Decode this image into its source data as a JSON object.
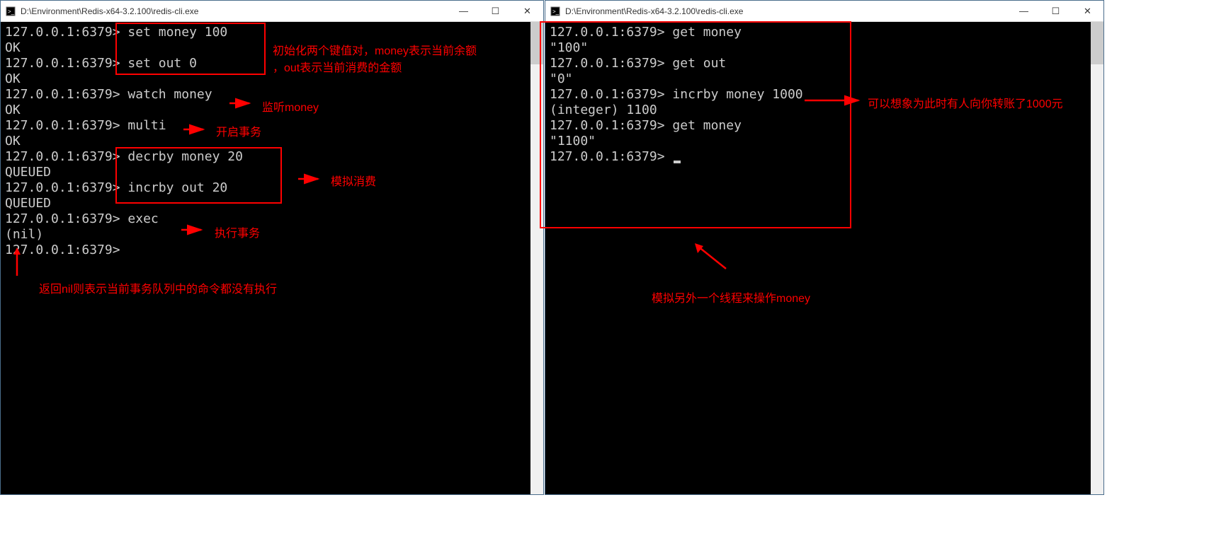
{
  "left": {
    "title": "D:\\Environment\\Redis-x64-3.2.100\\redis-cli.exe",
    "lines": [
      "127.0.0.1:6379> set money 100",
      "OK",
      "127.0.0.1:6379> set out 0",
      "OK",
      "127.0.0.1:6379> watch money",
      "OK",
      "127.0.0.1:6379> multi",
      "OK",
      "127.0.0.1:6379> decrby money 20",
      "QUEUED",
      "127.0.0.1:6379> incrby out 20",
      "QUEUED",
      "127.0.0.1:6379> exec",
      "(nil)",
      "127.0.0.1:6379>"
    ]
  },
  "right": {
    "title": "D:\\Environment\\Redis-x64-3.2.100\\redis-cli.exe",
    "lines": [
      "127.0.0.1:6379> get money",
      "\"100\"",
      "127.0.0.1:6379> get out",
      "\"0\"",
      "127.0.0.1:6379> incrby money 1000",
      "(integer) 1100",
      "127.0.0.1:6379> get money",
      "\"1100\"",
      "127.0.0.1:6379> "
    ]
  },
  "annotations": {
    "init": "初始化两个键值对，money表示当前余额",
    "init2": "，out表示当前消费的金额",
    "watch": "监听money",
    "multi": "开启事务",
    "consume": "模拟消费",
    "exec": "执行事务",
    "nil": "返回nil则表示当前事务队列中的命令都没有执行",
    "transfer": "可以想象为此时有人向你转账了1000元",
    "thread": "模拟另外一个线程来操作money"
  },
  "win_buttons": {
    "min": "—",
    "max": "☐",
    "close": "✕"
  }
}
